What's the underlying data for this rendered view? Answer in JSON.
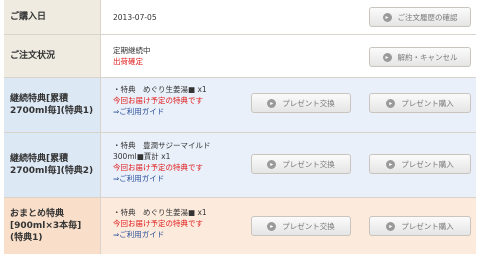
{
  "purchase_date": {
    "label": "ご購入日",
    "value": "2013-07-05",
    "button": "ご注文履歴の確認"
  },
  "order_status": {
    "label": "ご注文状況",
    "status_line1": "定期継続中",
    "status_line2": "出荷確定",
    "button": "解約・キャンセル"
  },
  "benefit_rows": [
    {
      "label_line1": "継続特典[累積",
      "label_line2": "2700ml毎](特典1)",
      "item1": "・特典　めぐり生姜湯■ x1",
      "item2": "",
      "notice": "今回お届け予定の特典です",
      "guide": "⇒ご利用ガイド",
      "exchange": "プレゼント交換",
      "purchase": "プレゼント購入"
    },
    {
      "label_line1": "継続特典[累積",
      "label_line2": "2700ml毎](特典2)",
      "item1": "・特典　豊潤サジーマイルド",
      "item2": "300ml■賈計 x1",
      "notice": "今回お届け予定の特典です",
      "guide": "⇒ご利用ガイド",
      "exchange": "プレゼント交換",
      "purchase": "プレゼント購入"
    },
    {
      "label_line1": "おまとめ特典",
      "label_line2": "[900ml×3本毎]",
      "label_line3": "(特典1)",
      "item1": "・特典　めぐり生姜湯■ x1",
      "item2": "",
      "notice": "今回お届け予定の特典です",
      "guide": "⇒ご利用ガイド",
      "exchange": "プレゼント交換",
      "purchase": "プレゼント購入"
    }
  ],
  "colors": {
    "notice_red": "#e01a1a",
    "link_blue": "#2a4f9a",
    "blue_row": "#e9f0fa",
    "orange_row": "#fcebdd"
  },
  "icons": {
    "button_icon": "circle-arrow-icon"
  }
}
